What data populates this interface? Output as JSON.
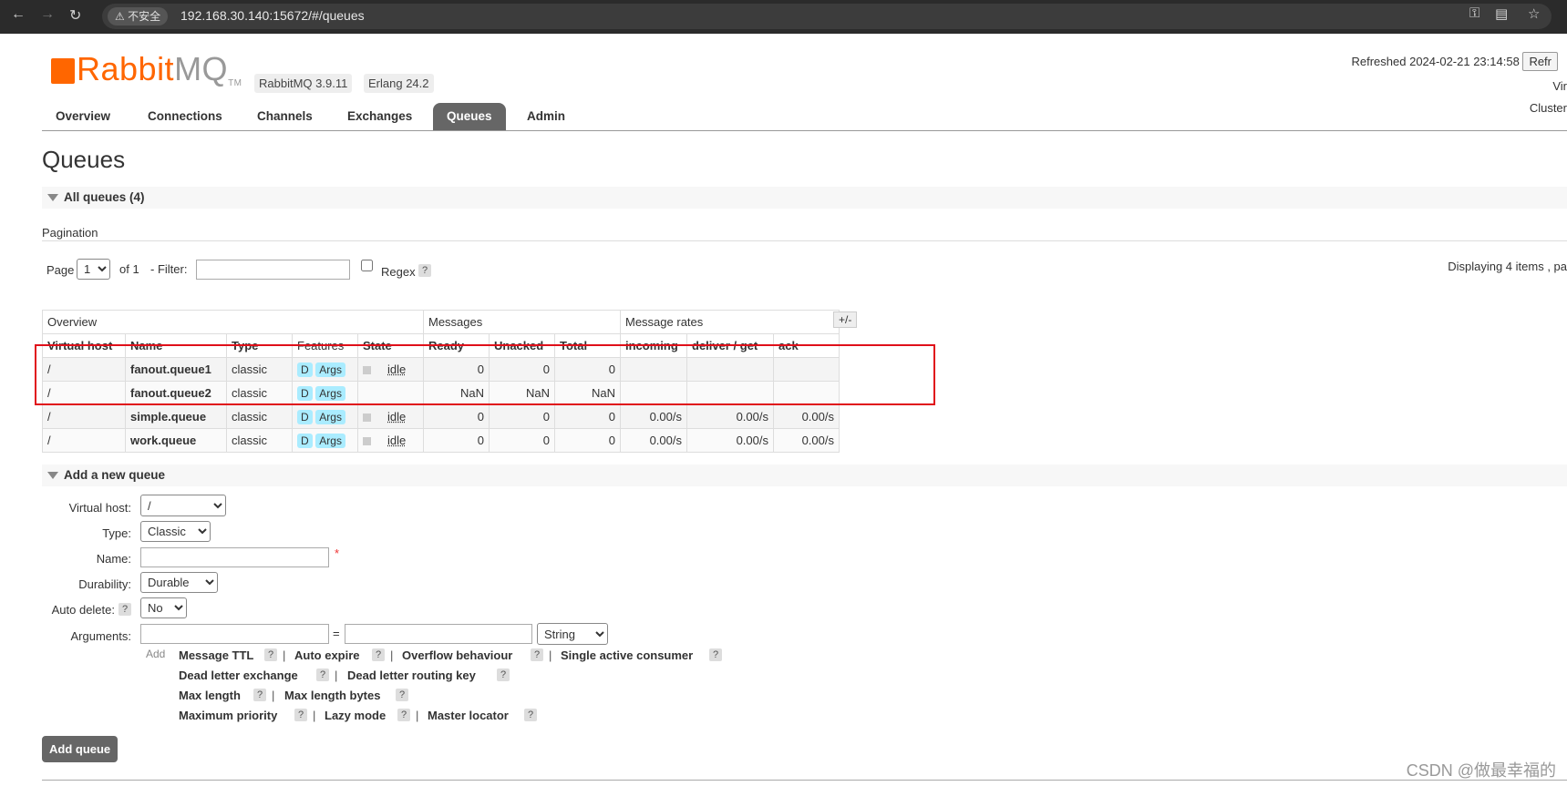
{
  "browser": {
    "security_label": "不安全",
    "url": "192.168.30.140:15672/#/queues"
  },
  "header": {
    "logo_rabbit": "Rabbit",
    "logo_mq": "MQ",
    "logo_tm": "TM",
    "version": "RabbitMQ 3.9.11",
    "erlang": "Erlang 24.2",
    "refreshed": "Refreshed 2024-02-21 23:14:58",
    "refresh_button": "Refr",
    "virtual_host_label": "Vir",
    "cluster_label": "Cluster"
  },
  "tabs": [
    {
      "label": "Overview"
    },
    {
      "label": "Connections"
    },
    {
      "label": "Channels"
    },
    {
      "label": "Exchanges"
    },
    {
      "label": "Queues",
      "active": true
    },
    {
      "label": "Admin"
    }
  ],
  "page": {
    "title": "Queues",
    "all_queues": "All queues (4)",
    "pagination": "Pagination",
    "page_label": "Page",
    "page_value": "1",
    "of_label": "of 1",
    "filter_label": "- Filter:",
    "regex_label": "Regex",
    "help": "?",
    "displaying": "Displaying 4 items , pa"
  },
  "table": {
    "groups": [
      "Overview",
      "Messages",
      "Message rates"
    ],
    "toggle": "+/-",
    "columns": [
      "Virtual host",
      "Name",
      "Type",
      "Features",
      "State",
      "Ready",
      "Unacked",
      "Total",
      "incoming",
      "deliver / get",
      "ack"
    ],
    "rows": [
      {
        "vhost": "/",
        "name": "fanout.queue1",
        "type": "classic",
        "d": "D",
        "args": "Args",
        "state": "idle",
        "ready": "0",
        "unacked": "0",
        "total": "0",
        "incoming": "",
        "deliver": "",
        "ack": ""
      },
      {
        "vhost": "/",
        "name": "fanout.queue2",
        "type": "classic",
        "d": "D",
        "args": "Args",
        "state": "",
        "ready": "NaN",
        "unacked": "NaN",
        "total": "NaN",
        "incoming": "",
        "deliver": "",
        "ack": ""
      },
      {
        "vhost": "/",
        "name": "simple.queue",
        "type": "classic",
        "d": "D",
        "args": "Args",
        "state": "idle",
        "ready": "0",
        "unacked": "0",
        "total": "0",
        "incoming": "0.00/s",
        "deliver": "0.00/s",
        "ack": "0.00/s"
      },
      {
        "vhost": "/",
        "name": "work.queue",
        "type": "classic",
        "d": "D",
        "args": "Args",
        "state": "idle",
        "ready": "0",
        "unacked": "0",
        "total": "0",
        "incoming": "0.00/s",
        "deliver": "0.00/s",
        "ack": "0.00/s"
      }
    ]
  },
  "add_queue": {
    "section_title": "Add a new queue",
    "virtual_host_label": "Virtual host:",
    "virtual_host_value": "/",
    "type_label": "Type:",
    "type_value": "Classic",
    "name_label": "Name:",
    "required_mark": "*",
    "durability_label": "Durability:",
    "durability_value": "Durable",
    "auto_delete_label": "Auto delete:",
    "auto_delete_value": "No",
    "arguments_label": "Arguments:",
    "equals": "=",
    "arg_type_value": "String",
    "add_label": "Add",
    "arg_links": [
      "Message TTL",
      "Auto expire",
      "Overflow behaviour",
      "Single active consumer",
      "Dead letter exchange",
      "Dead letter routing key",
      "Max length",
      "Max length bytes",
      "Maximum priority",
      "Lazy mode",
      "Master locator"
    ],
    "separator": "|",
    "submit": "Add queue"
  },
  "watermark": "CSDN @做最幸福的"
}
